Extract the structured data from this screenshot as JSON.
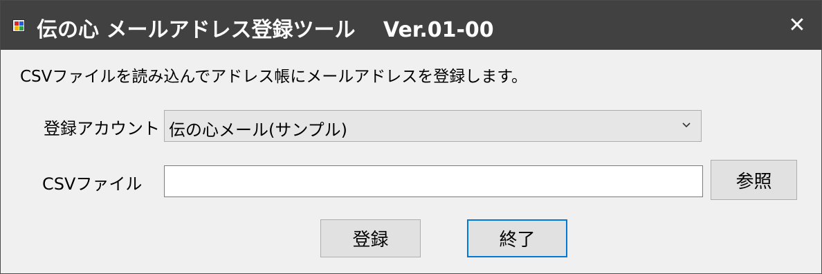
{
  "window": {
    "title": "伝の心 メールアドレス登録ツール　 Ver.01-00",
    "close_glyph": "✕"
  },
  "description": "CSVファイルを読み込んでアドレス帳にメールアドレスを登録します。",
  "form": {
    "account_label": "登録アカウント",
    "account_selected": "伝の心メール(サンプル)",
    "csv_label": "CSVファイル",
    "csv_value": "",
    "browse_label": "参照"
  },
  "buttons": {
    "register_label": "登録",
    "exit_label": "終了"
  },
  "colors": {
    "titlebar": "#414141",
    "window_bg": "#f0f0f0",
    "focus_border": "#0078d7"
  },
  "icons": {
    "app": "app-icon",
    "close": "close-icon",
    "dropdown": "chevron-down-icon"
  }
}
